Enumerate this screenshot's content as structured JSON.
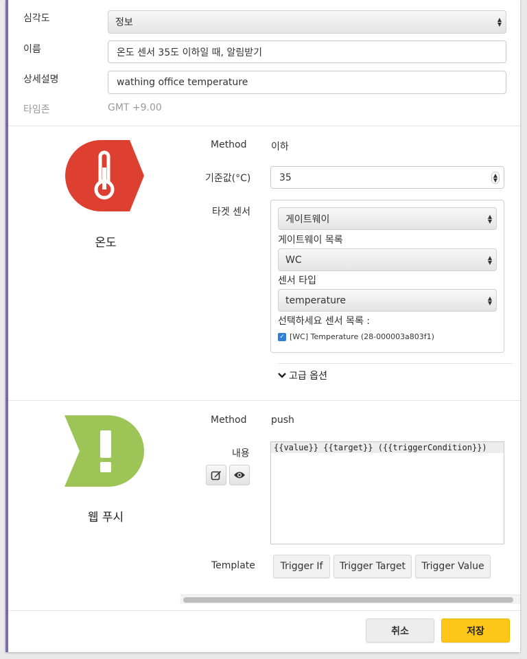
{
  "form": {
    "severity": {
      "label": "심각도",
      "value": "정보"
    },
    "name": {
      "label": "이름",
      "value": "온도 센서 35도 이하일 때, 알림받기"
    },
    "description": {
      "label": "상세설명",
      "value": "wathing office temperature"
    },
    "timezone": {
      "label": "타임존",
      "value": "GMT +9.00"
    }
  },
  "trigger": {
    "caption": "온도",
    "icon": "thermometer-icon",
    "color": "#dd4030",
    "method_label": "Method",
    "method_value": "이하",
    "threshold_label": "기준값(°C)",
    "threshold_value": "35",
    "target_label": "타겟 센서",
    "gateway_select": "게이트웨이",
    "gateway_list_label": "게이트웨이 목록",
    "gateway_list_select": "WC",
    "sensor_type_label": "센서 타입",
    "sensor_type_select": "temperature",
    "sensor_list_label": "선택하세요 센서 목록 :",
    "sensor_item": "[WC] Temperature (28-000003a803f1)",
    "sensor_item_checked": true,
    "advanced_label": "고급 옵션"
  },
  "action": {
    "caption": "웹 푸시",
    "icon": "exclamation-icon",
    "color": "#9cc456",
    "method_label": "Method",
    "method_value": "push",
    "content_label": "내용",
    "content_value": "{{value}} {{target}} ({{triggerCondition}})",
    "template_label": "Template",
    "template_buttons": [
      "Trigger If",
      "Trigger Target",
      "Trigger Value"
    ]
  },
  "footer": {
    "cancel_label": "취소",
    "save_label": "저장",
    "save_color": "#ffc61a"
  }
}
